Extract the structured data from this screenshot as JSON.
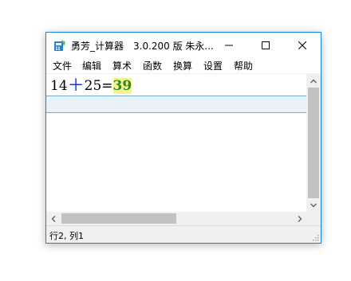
{
  "window": {
    "title": "勇芳_计算器　3.0.200 版  朱永...",
    "icon": "calculator-app-icon"
  },
  "controls": {
    "minimize_icon": "minimize-icon",
    "maximize_icon": "maximize-icon",
    "close_icon": "close-icon"
  },
  "menu": {
    "items": [
      {
        "label": "文件"
      },
      {
        "label": "编辑"
      },
      {
        "label": "算术"
      },
      {
        "label": "函数"
      },
      {
        "label": "换算"
      },
      {
        "label": "设置"
      },
      {
        "label": "帮助"
      }
    ]
  },
  "editor": {
    "line1": {
      "operand1": "14",
      "operator": "＋",
      "operand2": "25",
      "equals": "=",
      "result": "39"
    }
  },
  "colors": {
    "operator": "#1a35d6",
    "result_text": "#2a8a2a",
    "result_highlight": "#f3f58a",
    "current_line": "#e8f2fb",
    "accent_border": "#1883d7"
  },
  "status": {
    "position": "行2, 列1"
  }
}
